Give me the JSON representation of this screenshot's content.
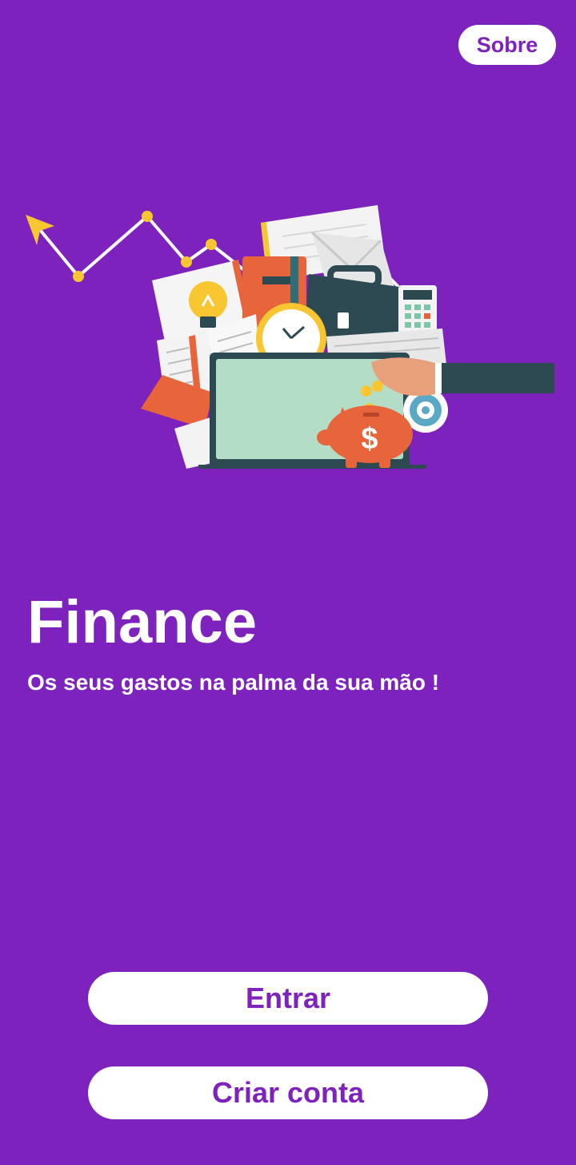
{
  "header": {
    "about_label": "Sobre"
  },
  "hero": {
    "illustration": "finance-illustration",
    "icons": [
      "trend-chart-icon",
      "lightbulb-icon",
      "book-icon",
      "notebook-icon",
      "envelope-icon",
      "briefcase-icon",
      "calculator-icon",
      "clock-icon",
      "keyboard-icon",
      "laptop-icon",
      "piggy-bank-icon",
      "coin-icon",
      "hand-icon",
      "target-icon"
    ]
  },
  "intro": {
    "title": "Finance",
    "subtitle": "Os seus gastos na palma da sua mão !"
  },
  "actions": {
    "login_label": "Entrar",
    "signup_label": "Criar conta"
  },
  "colors": {
    "background": "#7E22BE",
    "button_background": "#FFFFFF",
    "button_text": "#7E22BE",
    "accent_yellow": "#F8C630",
    "accent_orange": "#E8643A",
    "dark_teal": "#2D4A52",
    "mint": "#B3DDC6"
  }
}
